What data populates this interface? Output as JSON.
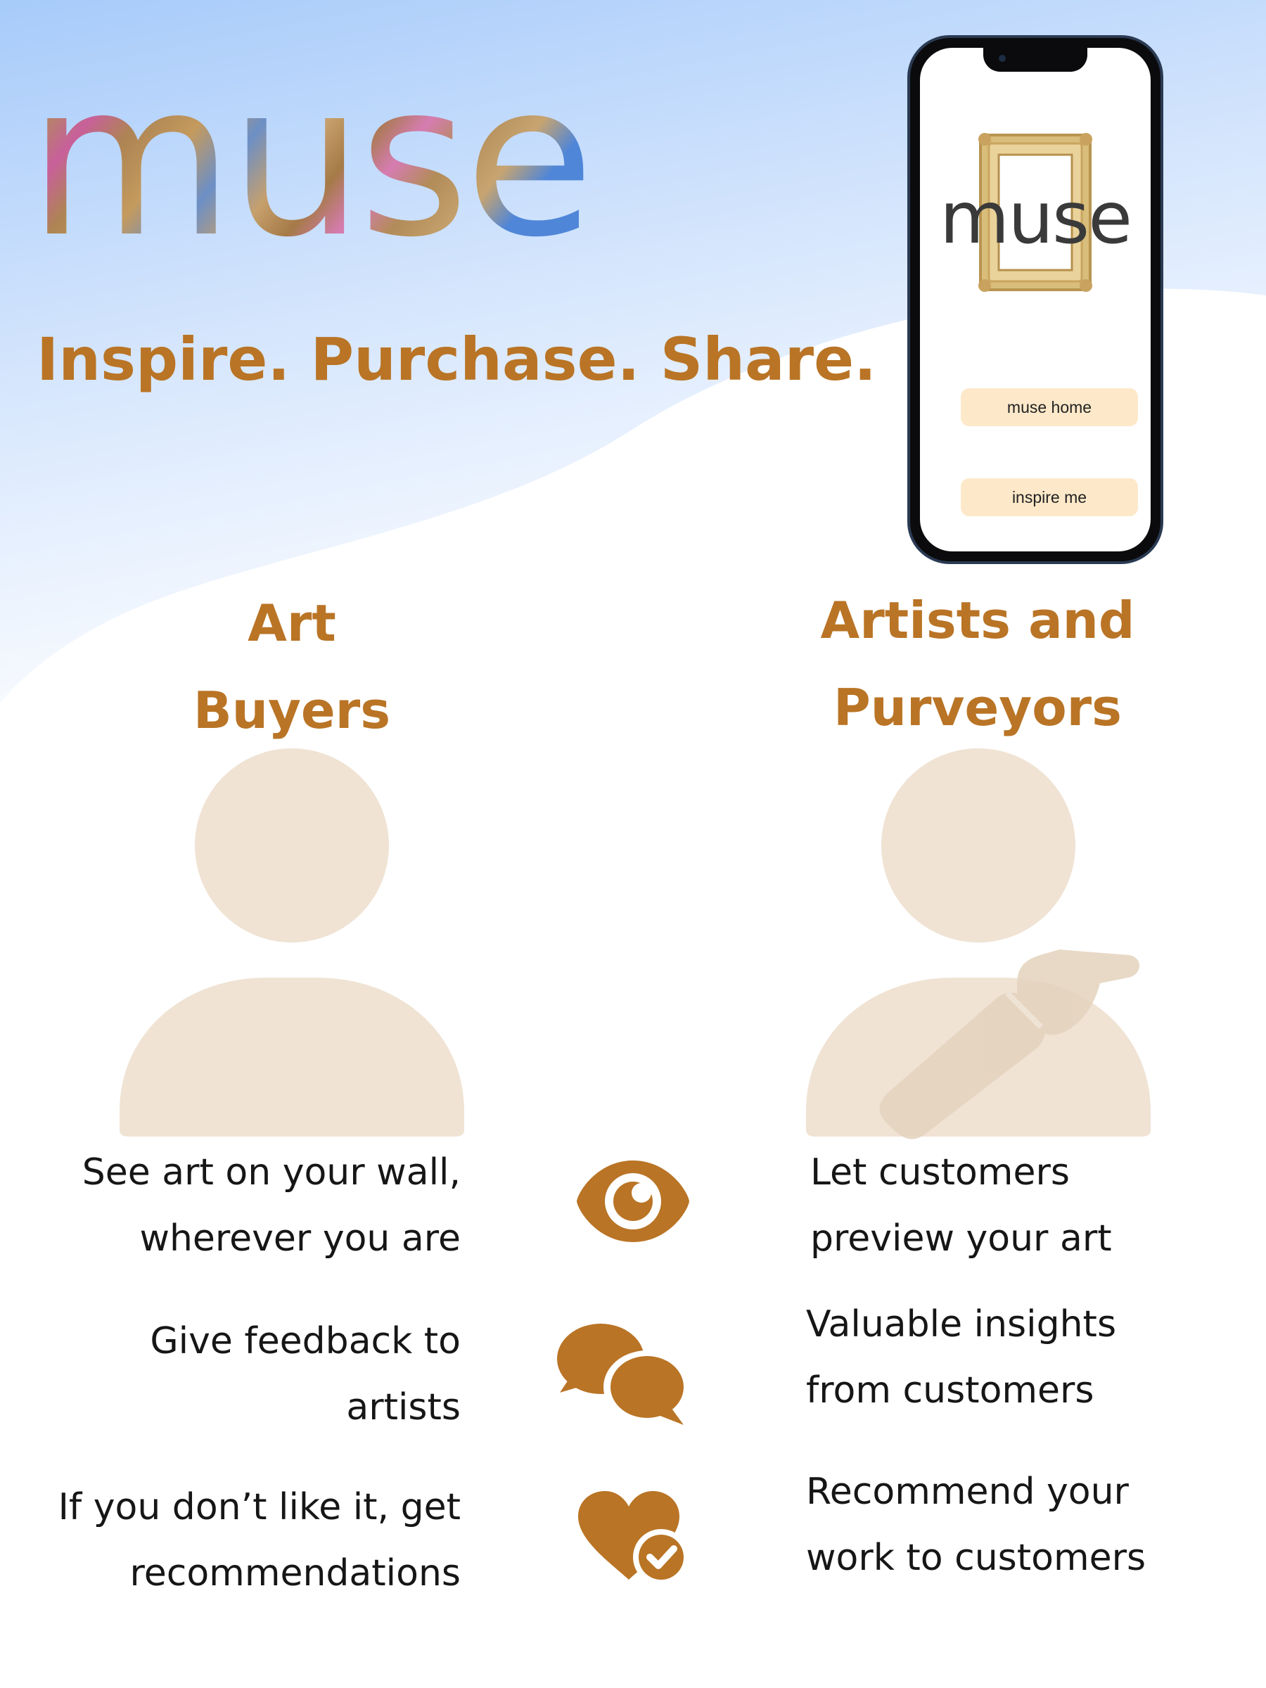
{
  "brand": {
    "name": "muse",
    "tagline": "Inspire. Purchase. Share."
  },
  "phone": {
    "app_name": "muse",
    "buttons": {
      "home": "muse home",
      "inspire": "inspire me"
    }
  },
  "columns": {
    "buyers": {
      "title_line1": "Art",
      "title_line2": "Buyers"
    },
    "artists": {
      "title_line1": "Artists and",
      "title_line2": "Purveyors"
    }
  },
  "features": [
    {
      "icon": "eye-icon",
      "buyer": [
        "See art on your wall,",
        "wherever you are"
      ],
      "artist": [
        "Let customers",
        "preview your art"
      ]
    },
    {
      "icon": "chat-bubbles-icon",
      "buyer": [
        "Give feedback to",
        "artists"
      ],
      "artist": [
        "Valuable insights",
        "from customers"
      ]
    },
    {
      "icon": "heart-check-icon",
      "buyer": [
        "If you don’t like it, get",
        "recommendations"
      ],
      "artist": [
        "Recommend your",
        "work to customers"
      ]
    }
  ],
  "colors": {
    "accent": "#b97425",
    "avatar": "#f0e3d4",
    "sky_top": "#a9cdfb",
    "button_fill": "#fde9c9"
  }
}
